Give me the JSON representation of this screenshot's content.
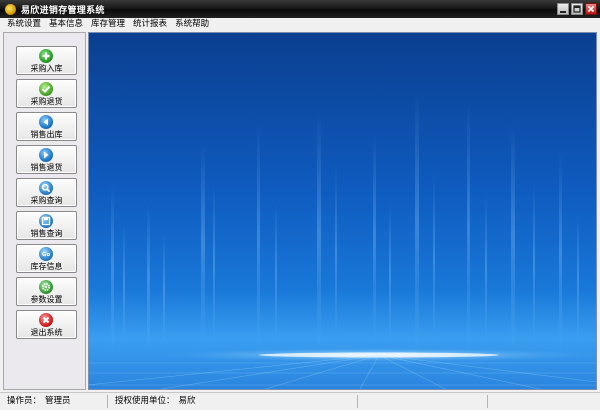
{
  "window": {
    "title": "易欣进销存管理系统",
    "icon": "app-logo-icon",
    "controls": [
      "minimize-icon",
      "maximize-icon",
      "close-icon"
    ]
  },
  "menu": [
    "系统设置",
    "基本信息",
    "库存管理",
    "统计报表",
    "系统帮助"
  ],
  "sidebar": {
    "buttons": [
      {
        "label": "采购入库",
        "icon": "plus-icon",
        "color": "#2e9e2e"
      },
      {
        "label": "采购退货",
        "icon": "check-icon",
        "color": "#4aa82a"
      },
      {
        "label": "销售出库",
        "icon": "arrow-left-icon",
        "color": "#1f78c8"
      },
      {
        "label": "销售退货",
        "icon": "arrow-right-icon",
        "color": "#1f78c8"
      },
      {
        "label": "采购查询",
        "icon": "magnifier-icon",
        "color": "#2a80c8"
      },
      {
        "label": "销售查询",
        "icon": "disk-icon",
        "color": "#2a80c8"
      },
      {
        "label": "库存信息",
        "icon": "go-icon",
        "color": "#2a80c8"
      },
      {
        "label": "参数设置",
        "icon": "gear-icon",
        "color": "#3a9a3a"
      },
      {
        "label": "退出系统",
        "icon": "close-circle-icon",
        "color": "#d02020"
      }
    ]
  },
  "statusbar": {
    "operator_label": "操作员：",
    "operator_value": "管理员",
    "license_label": "授权使用单位：",
    "license_value": "易欣"
  },
  "colors": {
    "background_blue_dark": "#0b3f90",
    "background_blue_light": "#3a9ef0",
    "titlebar": "#1a1a1a"
  }
}
